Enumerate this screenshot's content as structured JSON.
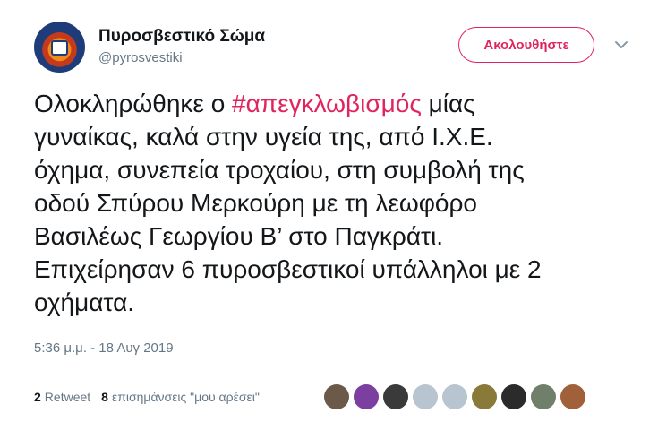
{
  "author": {
    "name": "Πυροσβεστικό Σώμα",
    "handle": "@pyrosvestiki"
  },
  "follow_label": "Ακολουθήστε",
  "tweet": {
    "lines": [
      {
        "before": "Ολοκληρώθηκε ο ",
        "hashtag": "#απεγκλωβισμός",
        "after": " μίας"
      },
      {
        "text": "γυναίκας, καλά στην υγεία της, από Ι.Χ.Ε."
      },
      {
        "text": "όχημα, συνεπεία τροχαίου, στη συμβολή της"
      },
      {
        "text": "οδού Σπύρου Μερκούρη με τη λεωφόρο"
      },
      {
        "text": "Βασιλέως Γεωργίου Β’ στο Παγκράτι."
      },
      {
        "text": "Επιχείρησαν 6 πυροσβεστικοί υπάλληλοι με 2"
      },
      {
        "text": "οχήματα."
      }
    ]
  },
  "timestamp": "5:36 μ.μ. - 18 Αυγ 2019",
  "stats": {
    "retweets_count": "2",
    "retweets_label": "Retweet",
    "likes_count": "8",
    "likes_label": "επισημάνσεις \"μου αρέσει\""
  },
  "facepile": [
    {
      "color": "#6b5a4a"
    },
    {
      "color": "#7b3fa0"
    },
    {
      "color": "#3a3a3a"
    },
    {
      "color": "#b8c4cf"
    },
    {
      "color": "#b8c4cf"
    },
    {
      "color": "#8a7a3a"
    },
    {
      "color": "#2b2b2b"
    },
    {
      "color": "#6f7f6a"
    },
    {
      "color": "#a0603a"
    }
  ],
  "colors": {
    "accent": "#e0245e",
    "text": "#14171a",
    "secondary": "#657786"
  },
  "icons": {
    "caret": "chevron-down-icon"
  }
}
